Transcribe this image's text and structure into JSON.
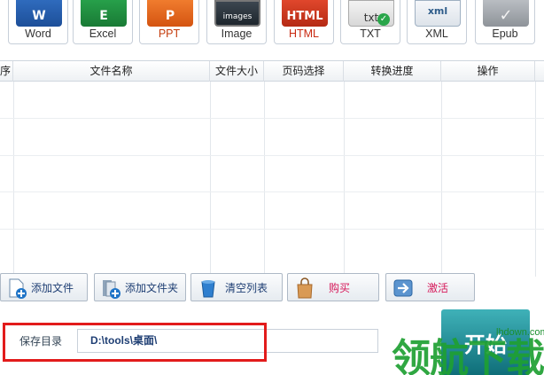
{
  "formats": [
    {
      "label": "Word",
      "glyph": "W"
    },
    {
      "label": "Excel",
      "glyph": "E"
    },
    {
      "label": "PPT",
      "glyph": "P"
    },
    {
      "label": "Image",
      "glyph": "images"
    },
    {
      "label": "HTML",
      "glyph": "HTML"
    },
    {
      "label": "TXT",
      "glyph": "txt"
    },
    {
      "label": "XML",
      "glyph": "xml"
    },
    {
      "label": "Epub",
      "glyph": "✓"
    }
  ],
  "table": {
    "headers": [
      "序",
      "文件名称",
      "文件大小",
      "页码选择",
      "转换进度",
      "操作"
    ]
  },
  "actions": [
    {
      "label": "添加文件"
    },
    {
      "label": "添加文件夹"
    },
    {
      "label": "清空列表"
    },
    {
      "label": "购买"
    },
    {
      "label": "激活"
    }
  ],
  "save": {
    "label": "保存目录",
    "path": "D:\\tools\\桌面\\"
  },
  "start_label": "开始",
  "watermark": {
    "text": "领航下载",
    "url": "lhdown.com"
  },
  "colors": {
    "highlight_frame": "#e21b1b",
    "start_button": "#1a8a95",
    "buy_text": "#d6195a"
  }
}
